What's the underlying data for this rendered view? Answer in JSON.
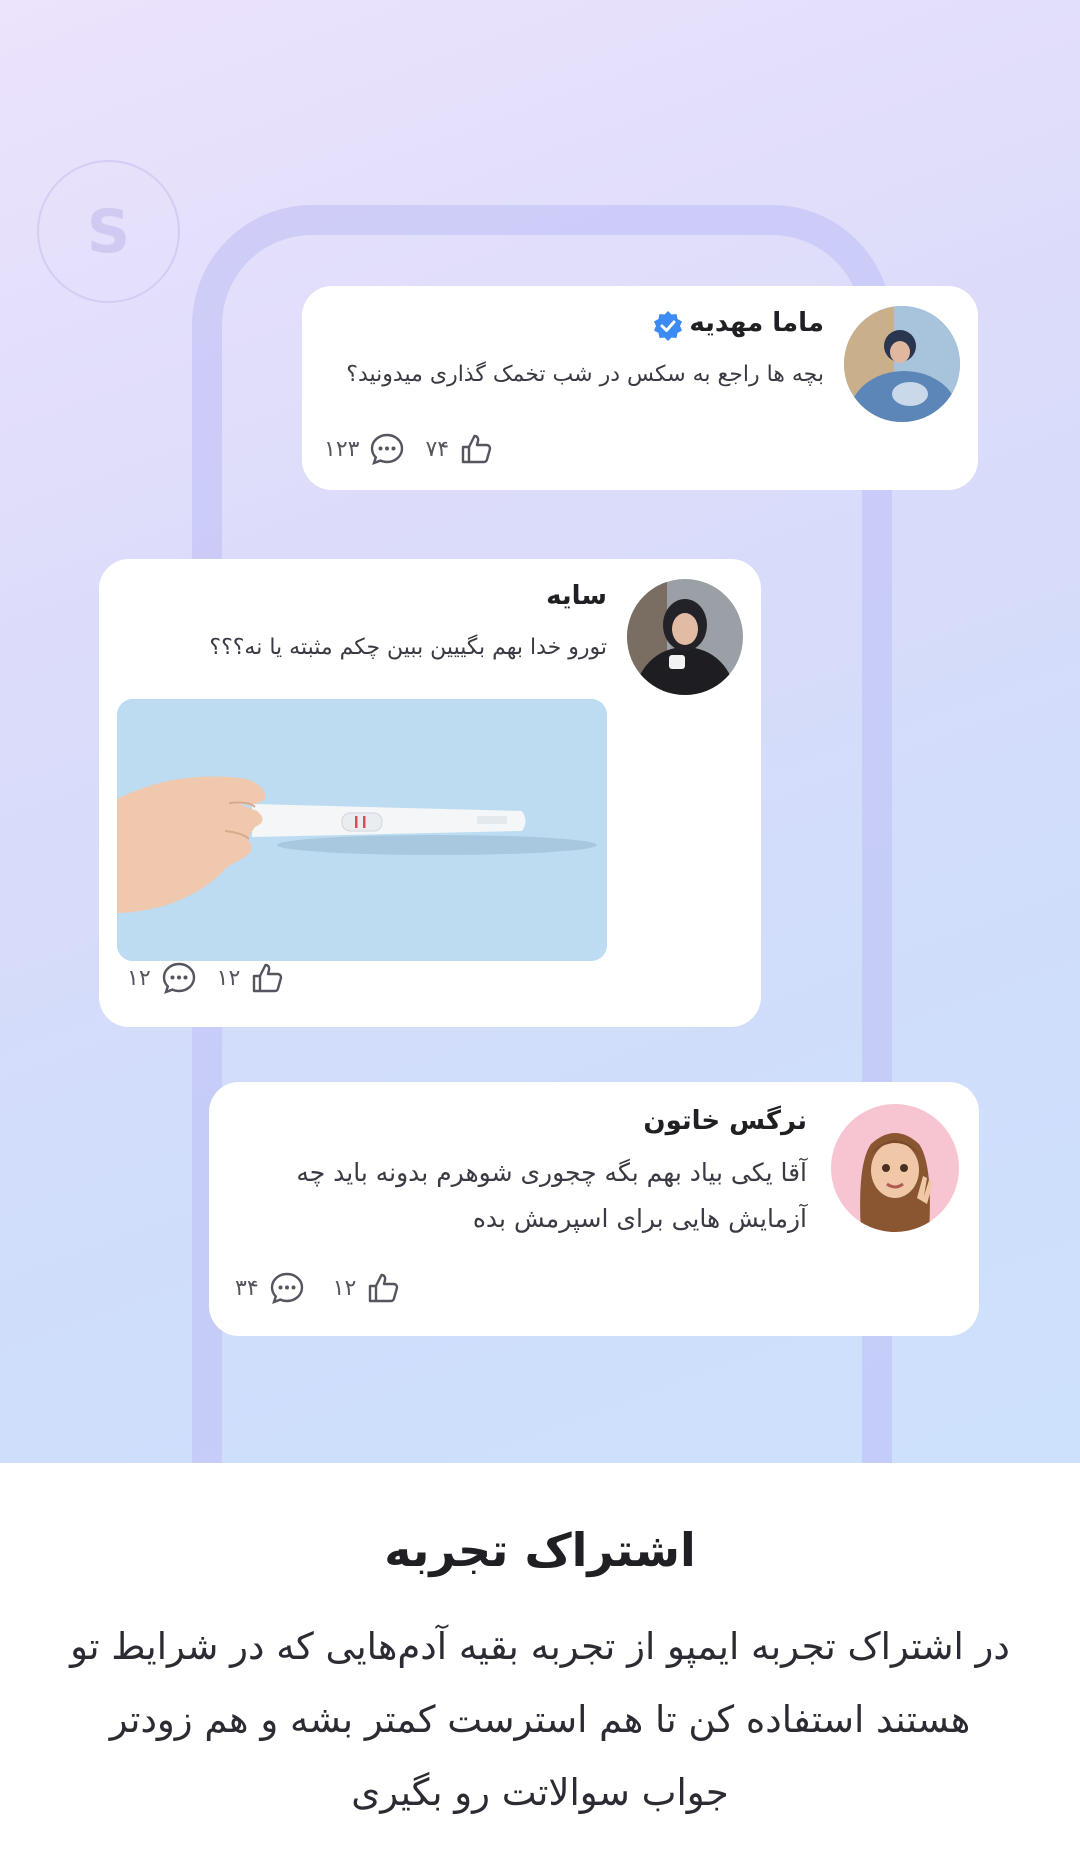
{
  "posts": [
    {
      "name": "ماما مهدیه",
      "text": "بچه ها راجع به سکس در شب تخمک گذاری میدونید؟",
      "likes": "۷۴",
      "comments": "۱۲۳"
    },
    {
      "name": "سایه",
      "text": "تورو خدا بهم بگییین ببین چکم مثبته یا نه؟؟؟",
      "likes": "۱۲",
      "comments": "۱۲"
    },
    {
      "name": "نرگس خاتون",
      "text": "آقا یکی بیاد بهم بگه چجوری شوهرم بدونه باید چه آزمایش هایی برای اسپرمش بده",
      "likes": "۱۲",
      "comments": "۳۴"
    }
  ],
  "feature": {
    "title": "اشتراک تجربه",
    "description": "در اشتراک تجربه ایمپو از تجربه بقیه آدم‌هایی که در شرایط تو هستند استفاده کن تا هم استرست کمتر بشه و هم زودتر جواب سوالاتت رو بگیری"
  },
  "colors": {
    "verified": "#3b8bf2",
    "accent_bg": "#cfddfb"
  },
  "icons": [
    "verified-badge-icon",
    "like-icon",
    "comment-icon"
  ]
}
